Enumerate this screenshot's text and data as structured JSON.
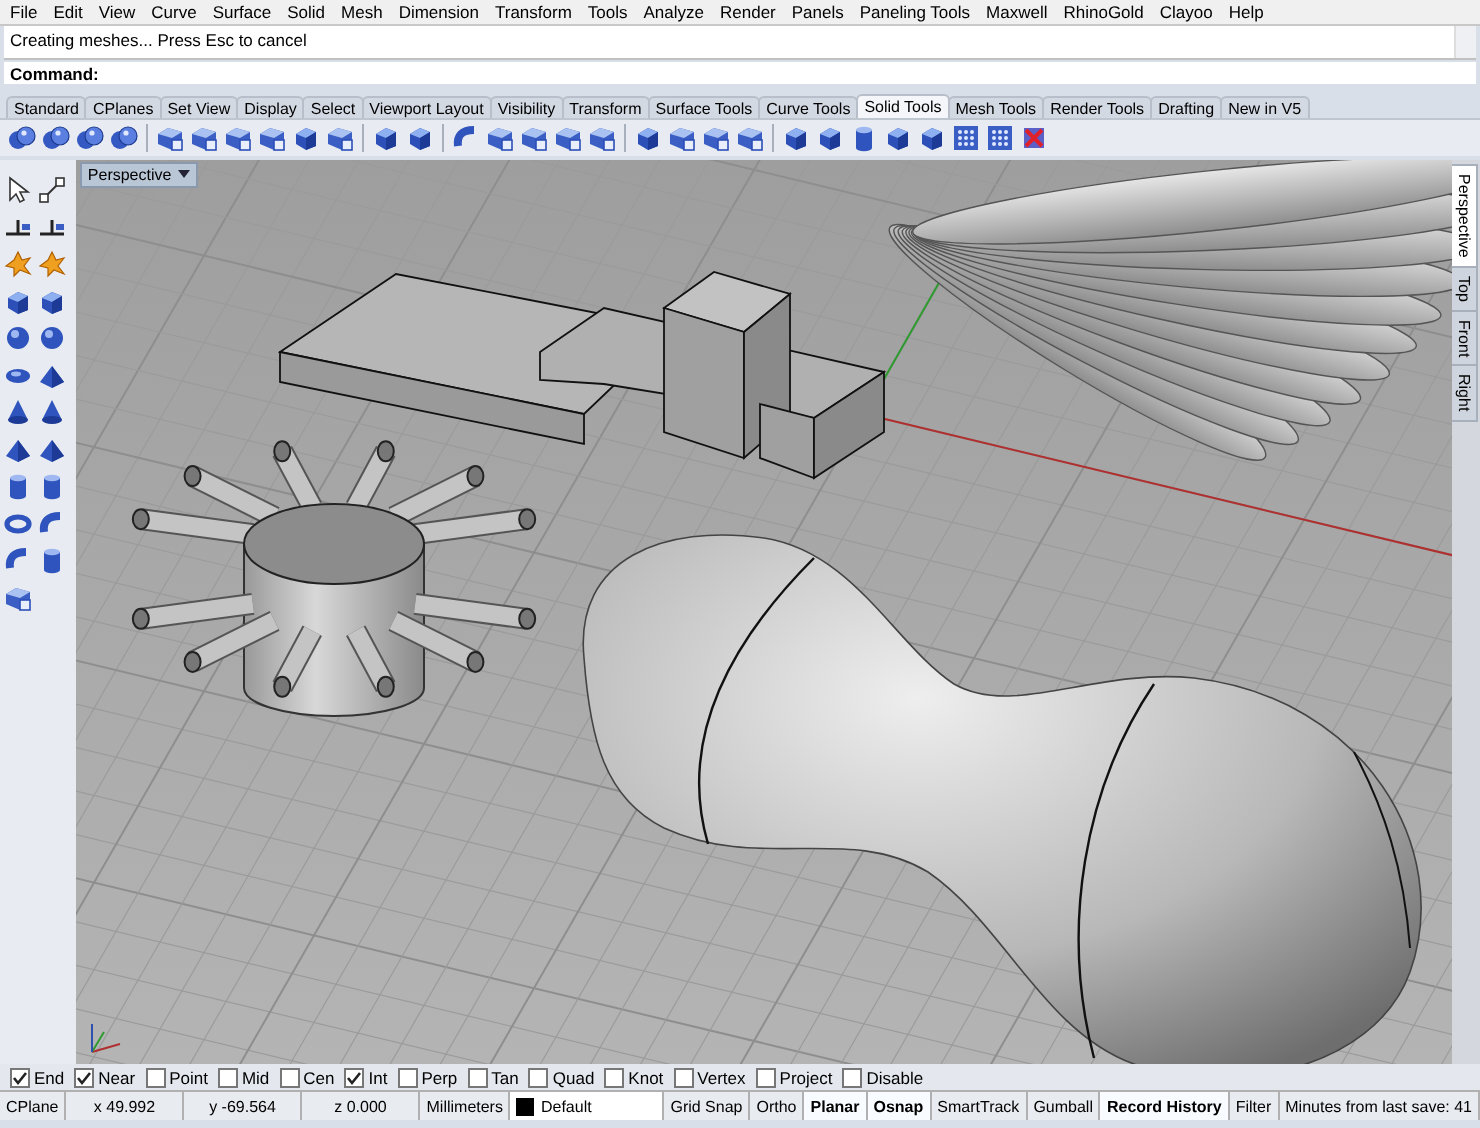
{
  "menu": [
    "File",
    "Edit",
    "View",
    "Curve",
    "Surface",
    "Solid",
    "Mesh",
    "Dimension",
    "Transform",
    "Tools",
    "Analyze",
    "Render",
    "Panels",
    "Paneling Tools",
    "Maxwell",
    "RhinoGold",
    "Clayoo",
    "Help"
  ],
  "command_history": [
    "Creating meshes... Press Esc to cancel"
  ],
  "command": {
    "label": "Command:"
  },
  "toolbar_tabs": [
    {
      "label": "Standard",
      "selected": false
    },
    {
      "label": "CPlanes",
      "selected": false
    },
    {
      "label": "Set View",
      "selected": false
    },
    {
      "label": "Display",
      "selected": false
    },
    {
      "label": "Select",
      "selected": false
    },
    {
      "label": "Viewport Layout",
      "selected": false
    },
    {
      "label": "Visibility",
      "selected": false
    },
    {
      "label": "Transform",
      "selected": false
    },
    {
      "label": "Surface Tools",
      "selected": false
    },
    {
      "label": "Curve Tools",
      "selected": false
    },
    {
      "label": "Solid Tools",
      "selected": true
    },
    {
      "label": "Mesh Tools",
      "selected": false
    },
    {
      "label": "Render Tools",
      "selected": false
    },
    {
      "label": "Drafting",
      "selected": false
    },
    {
      "label": "New in V5",
      "selected": false
    }
  ],
  "viewport": {
    "title": "Perspective"
  },
  "viewport_tabs": [
    {
      "label": "Perspective",
      "selected": true
    },
    {
      "label": "Top",
      "selected": false
    },
    {
      "label": "Front",
      "selected": false
    },
    {
      "label": "Right",
      "selected": false
    }
  ],
  "osnaps": [
    {
      "label": "End",
      "checked": true
    },
    {
      "label": "Near",
      "checked": true
    },
    {
      "label": "Point",
      "checked": false
    },
    {
      "label": "Mid",
      "checked": false
    },
    {
      "label": "Cen",
      "checked": false
    },
    {
      "label": "Int",
      "checked": true
    },
    {
      "label": "Perp",
      "checked": false
    },
    {
      "label": "Tan",
      "checked": false
    },
    {
      "label": "Quad",
      "checked": false
    },
    {
      "label": "Knot",
      "checked": false
    },
    {
      "label": "Vertex",
      "checked": false
    },
    {
      "label": "Project",
      "checked": false
    },
    {
      "label": "Disable",
      "checked": false
    }
  ],
  "status_bar": [
    {
      "text": "CPlane",
      "kind": "plain"
    },
    {
      "text": "x 49.992",
      "kind": "coord"
    },
    {
      "text": "y -69.564",
      "kind": "coord"
    },
    {
      "text": "z 0.000",
      "kind": "coord"
    },
    {
      "text": "Millimeters",
      "kind": "plain"
    },
    {
      "text": "Default",
      "kind": "layer",
      "color": "#000000"
    },
    {
      "text": "Grid Snap",
      "kind": "toggle",
      "on": false
    },
    {
      "text": "Ortho",
      "kind": "toggle",
      "on": false
    },
    {
      "text": "Planar",
      "kind": "toggle",
      "on": true
    },
    {
      "text": "Osnap",
      "kind": "toggle",
      "on": true
    },
    {
      "text": "SmartTrack",
      "kind": "toggle",
      "on": false
    },
    {
      "text": "Gumball",
      "kind": "toggle",
      "on": false
    },
    {
      "text": "Record History",
      "kind": "toggle",
      "on": true
    },
    {
      "text": "Filter",
      "kind": "toggle",
      "on": false
    },
    {
      "text": "Minutes from last save: 41",
      "kind": "plain"
    }
  ]
}
